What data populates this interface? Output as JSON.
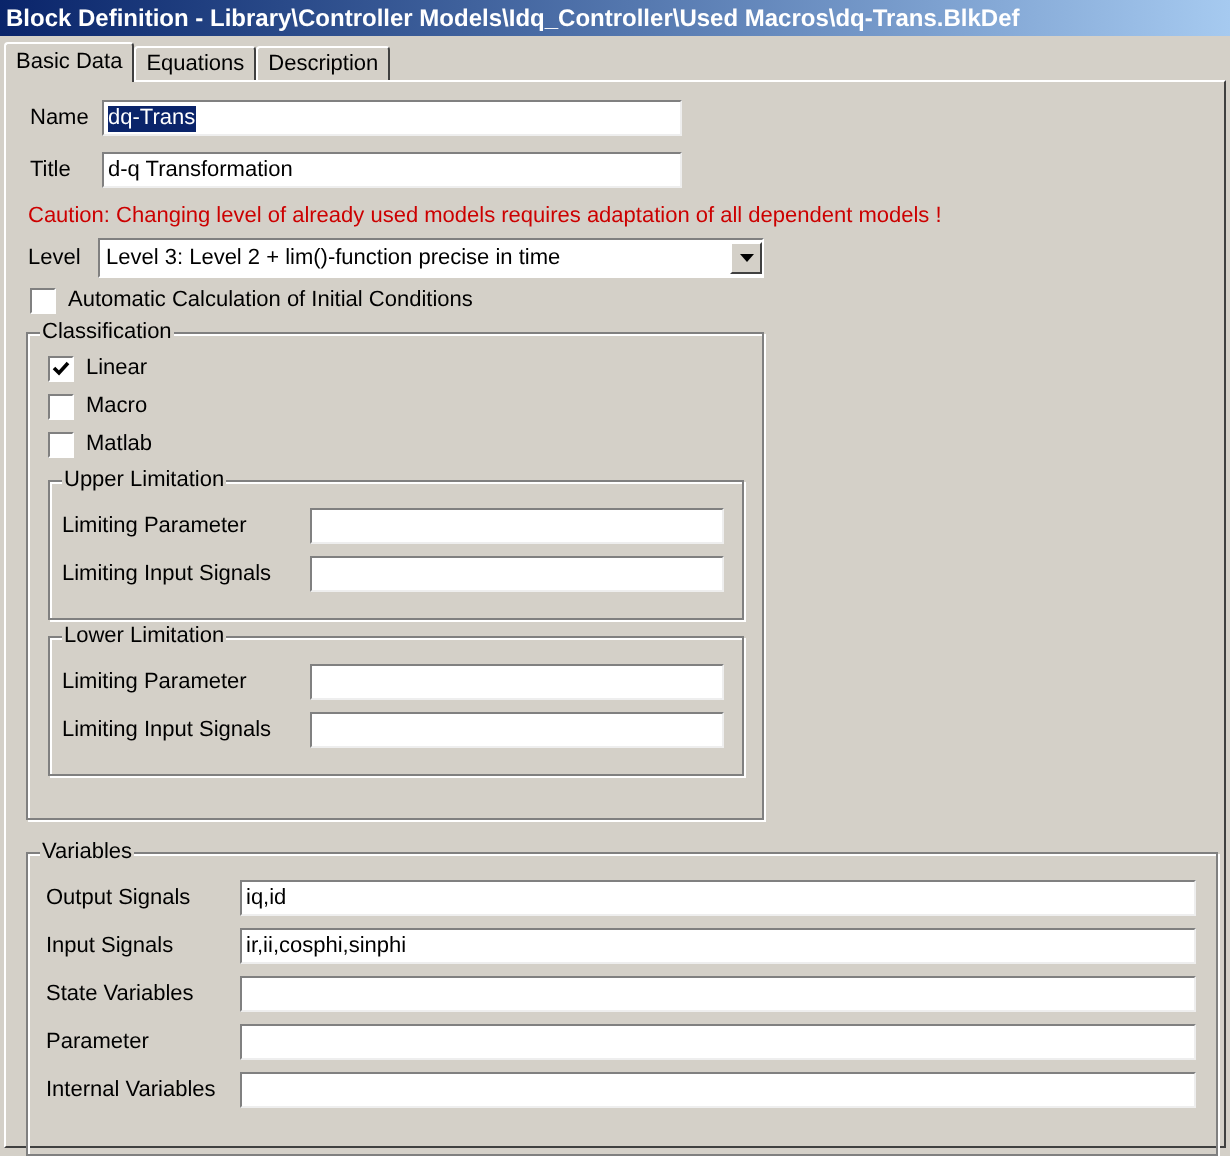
{
  "window": {
    "title": "Block Definition - Library\\Controller Models\\Idq_Controller\\Used Macros\\dq-Trans.BlkDef"
  },
  "tabs": [
    {
      "label": "Basic Data",
      "selected": true
    },
    {
      "label": "Equations",
      "selected": false
    },
    {
      "label": "Description",
      "selected": false
    }
  ],
  "name": {
    "label": "Name",
    "value": "dq-Trans",
    "text_selected": true
  },
  "title": {
    "label": "Title",
    "value": "d-q Transformation",
    "text_selected": false
  },
  "caution": "Caution: Changing level of already used models requires adaptation of all dependent models !",
  "level": {
    "label": "Level",
    "value": "Level 3: Level 2 + lim()-function precise in time"
  },
  "automatic_initial_conditions": {
    "label": "Automatic Calculation of Initial Conditions",
    "checked": false
  },
  "classification": {
    "title": "Classification",
    "options": [
      {
        "label": "Linear",
        "checked": true
      },
      {
        "label": "Macro",
        "checked": false
      },
      {
        "label": "Matlab",
        "checked": false
      }
    ],
    "limitations": [
      {
        "title": "Upper Limitation",
        "fields": [
          {
            "label": "Limiting Parameter"
          },
          {
            "label": "Limiting Input Signals"
          }
        ]
      },
      {
        "title": "Lower Limitation",
        "fields": [
          {
            "label": "Limiting Parameter"
          },
          {
            "label": "Limiting Input Signals"
          }
        ]
      }
    ]
  },
  "variables": {
    "title": "Variables",
    "fields": [
      {
        "label": "Output Signals",
        "value": "iq,id"
      },
      {
        "label": "Input Signals",
        "value": "ir,ii,cosphi,sinphi"
      },
      {
        "label": "State Variables"
      },
      {
        "label": "Parameter"
      },
      {
        "label": "Internal Variables"
      }
    ]
  }
}
